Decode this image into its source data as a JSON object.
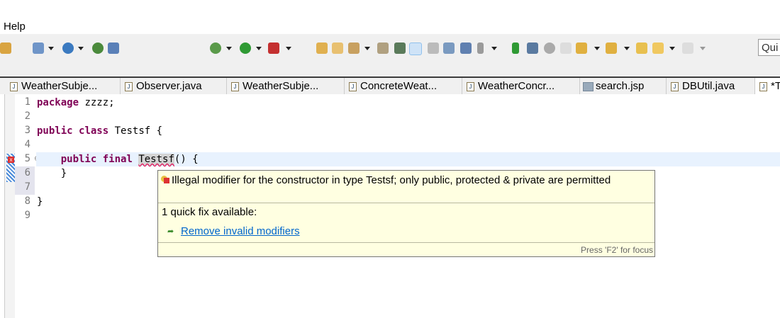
{
  "menu": {
    "help": "Help"
  },
  "toolbar": {
    "quick_access_placeholder": "Qui"
  },
  "tabs": [
    {
      "label": "WeatherSubje...",
      "icon": "java-file-icon"
    },
    {
      "label": "Observer.java",
      "icon": "java-file-icon"
    },
    {
      "label": "WeatherSubje...",
      "icon": "java-file-icon"
    },
    {
      "label": "ConcreteWeat...",
      "icon": "java-file-icon"
    },
    {
      "label": "WeatherConcr...",
      "icon": "java-file-icon"
    },
    {
      "label": "search.jsp",
      "icon": "jsp-file-icon"
    },
    {
      "label": "DBUtil.java",
      "icon": "java-file-icon"
    },
    {
      "label": "*T",
      "icon": "java-file-icon"
    }
  ],
  "editor": {
    "line_numbers": [
      "1",
      "2",
      "3",
      "4",
      "5",
      "6",
      "7",
      "8",
      "9"
    ],
    "lines": {
      "l1_kw": "package",
      "l1_rest": " zzzz;",
      "l3_kw1": "public",
      "l3_kw2": "class",
      "l3_rest": " Testsf {",
      "l5_kw1": "public",
      "l5_kw2": "final",
      "l5_name": "Testsf",
      "l5_rest": "() {",
      "l6": "    }",
      "l8": "}"
    }
  },
  "tooltip": {
    "message": "Illegal modifier for the constructor in type Testsf; only public, protected & private are permitted",
    "quick_fix_count": "1 quick fix available:",
    "fix_label": "Remove invalid modifiers",
    "focus_hint": "Press 'F2' for focus"
  },
  "colors": {
    "keyword": "#7f0055",
    "tooltip_bg": "#ffffe1",
    "link": "#0066cc"
  }
}
